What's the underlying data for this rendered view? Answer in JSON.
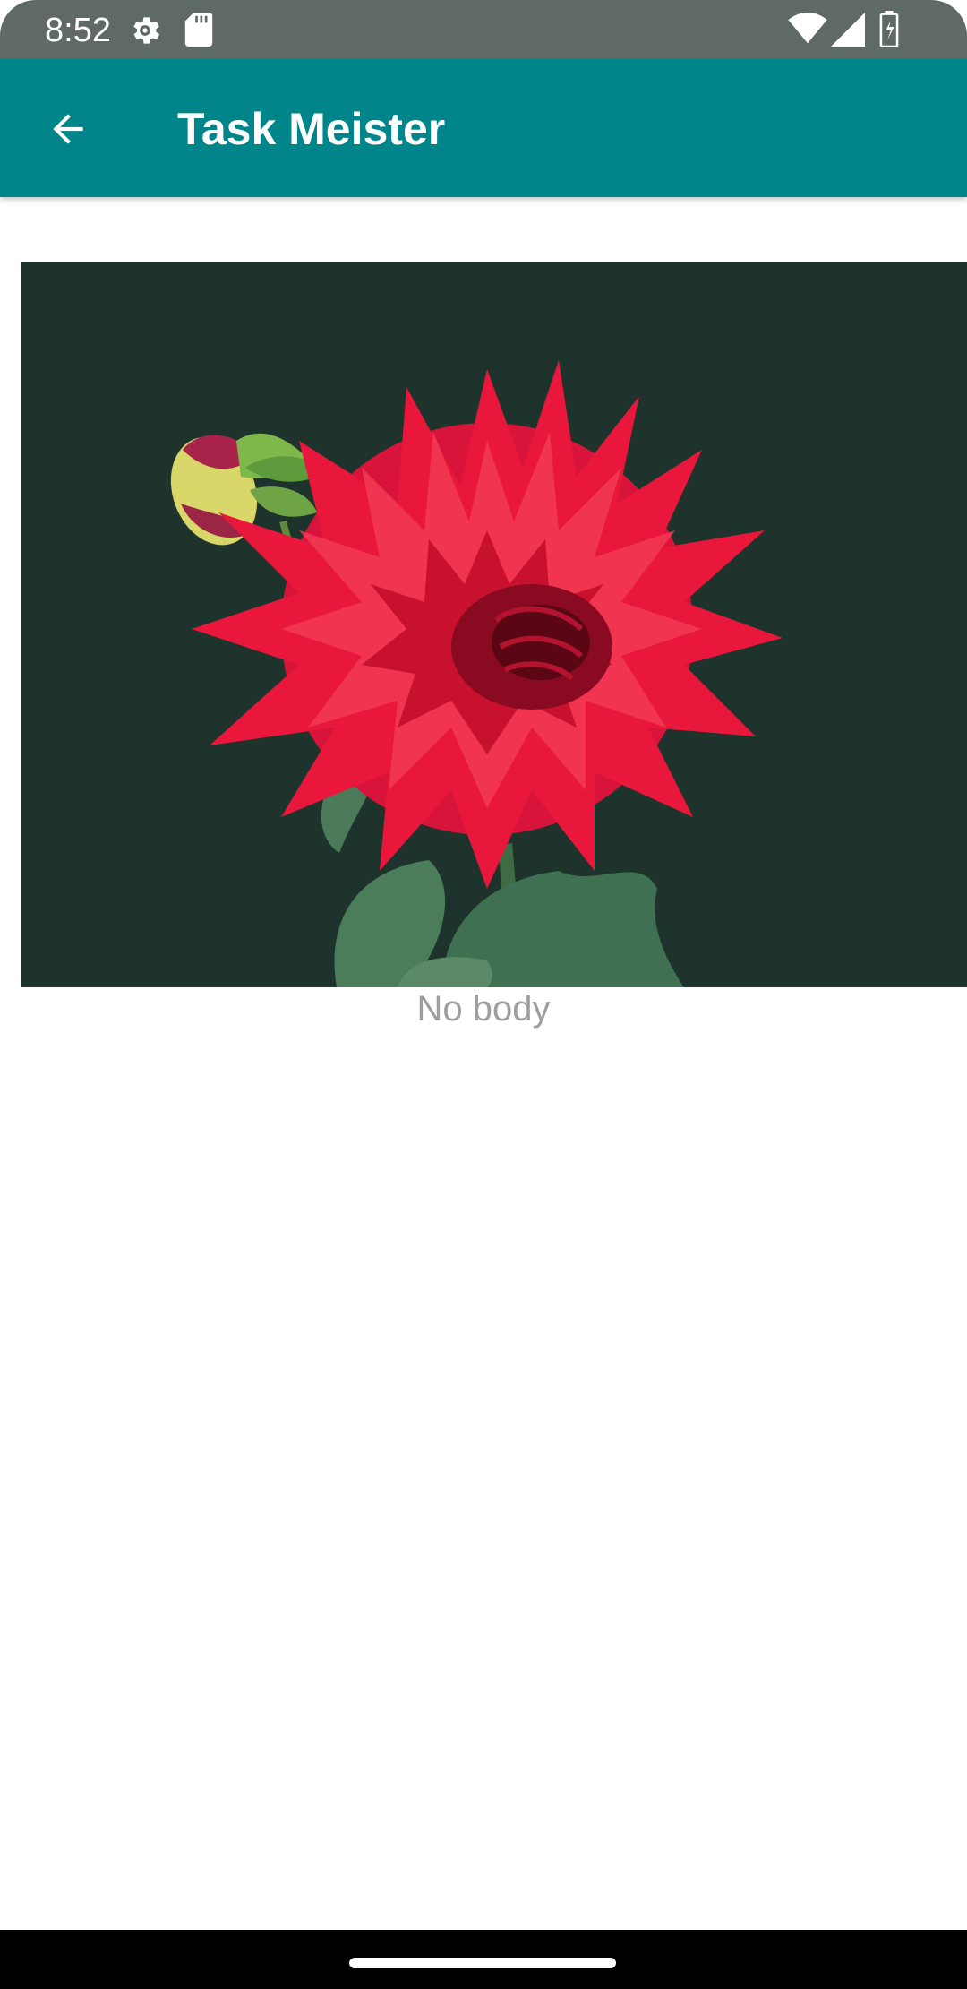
{
  "status_bar": {
    "time": "8:52",
    "icons": [
      "settings-icon",
      "sd-card-icon",
      "wifi-icon",
      "signal-icon",
      "battery-icon"
    ]
  },
  "app_bar": {
    "title": "Task Meister",
    "back_icon": "arrow-back-icon",
    "color": "#00868a"
  },
  "task": {
    "image_subject": "red dahlia flower with bud on dark green background",
    "body_placeholder": "No body"
  },
  "colors": {
    "status_bar": "#5f6a66",
    "image_background": "#1e332b",
    "flower": "#e8173b",
    "placeholder_text": "#9e9e9e"
  }
}
